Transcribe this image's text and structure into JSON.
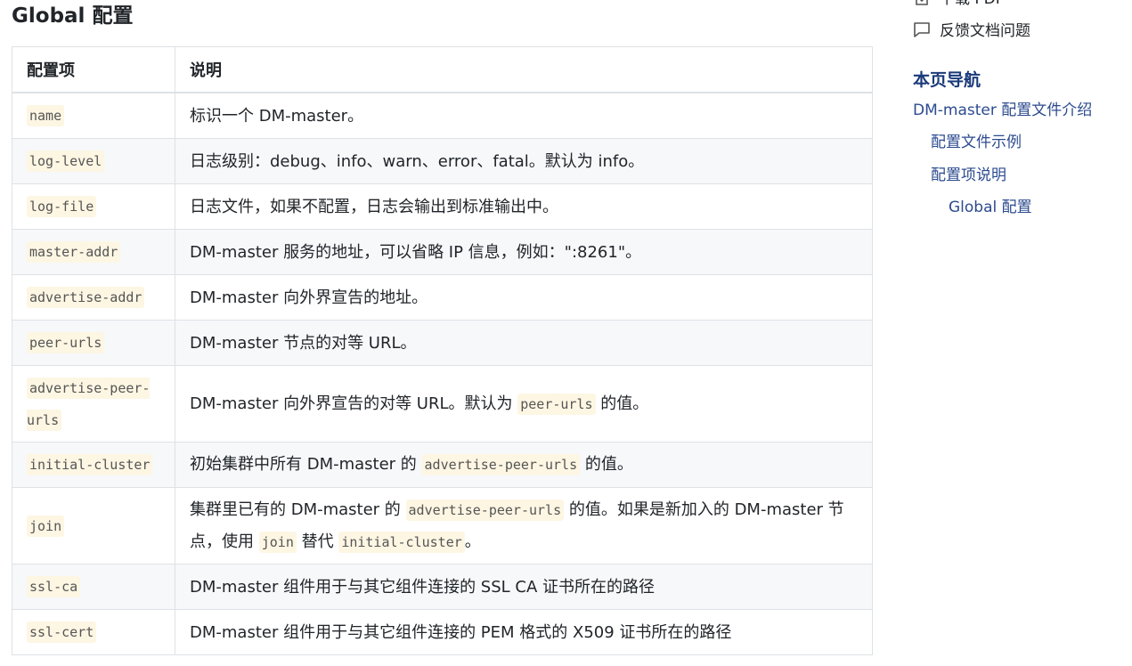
{
  "page": {
    "title": "Global 配置"
  },
  "table": {
    "headers": [
      "配置项",
      "说明"
    ],
    "rows": [
      {
        "key": "name",
        "desc": [
          "标识一个 DM-master。"
        ]
      },
      {
        "key": "log-level",
        "desc": [
          "日志级别：debug、info、warn、error、fatal。默认为 info。"
        ]
      },
      {
        "key": "log-file",
        "desc": [
          "日志文件，如果不配置，日志会输出到标准输出中。"
        ]
      },
      {
        "key": "master-addr",
        "desc": [
          "DM-master 服务的地址，可以省略 IP 信息，例如：\":8261\"。"
        ]
      },
      {
        "key": "advertise-addr",
        "desc": [
          "DM-master 向外界宣告的地址。"
        ]
      },
      {
        "key": "peer-urls",
        "desc": [
          "DM-master 节点的对等 URL。"
        ]
      },
      {
        "key": "advertise-peer-urls",
        "desc": [
          "DM-master 向外界宣告的对等 URL。默认为 ",
          {
            "code": "peer-urls"
          },
          " 的值。"
        ]
      },
      {
        "key": "initial-cluster",
        "desc": [
          "初始集群中所有 DM-master 的 ",
          {
            "code": "advertise-peer-urls"
          },
          " 的值。"
        ]
      },
      {
        "key": "join",
        "desc": [
          "集群里已有的 DM-master 的 ",
          {
            "code": "advertise-peer-urls"
          },
          " 的值。如果是新加入的 DM-master 节点，使用 ",
          {
            "code": "join"
          },
          " 替代 ",
          {
            "code": "initial-cluster"
          },
          "。"
        ]
      },
      {
        "key": "ssl-ca",
        "desc": [
          "DM-master 组件用于与其它组件连接的 SSL CA 证书所在的路径"
        ]
      },
      {
        "key": "ssl-cert",
        "desc": [
          "DM-master 组件用于与其它组件连接的 PEM 格式的 X509 证书所在的路径"
        ]
      }
    ]
  },
  "toc": {
    "download_label": "下载 PDF",
    "feedback_label": "反馈文档问题",
    "heading": "本页导航",
    "items": [
      "DM-master 配置文件介绍",
      "配置文件示例",
      "配置项说明",
      "Global 配置"
    ]
  },
  "icons": {
    "download": "file-download-icon",
    "feedback": "chat-bubble-icon"
  }
}
